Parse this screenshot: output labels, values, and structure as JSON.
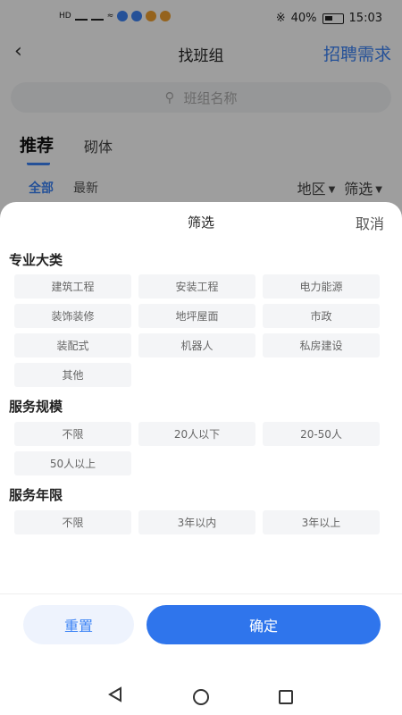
{
  "status_bar": {
    "battery": "40%",
    "time": "15:03"
  },
  "nav": {
    "title": "找班组",
    "action": "招聘需求"
  },
  "search": {
    "placeholder": "班组名称"
  },
  "tabs": [
    {
      "label": "推荐",
      "active": true
    },
    {
      "label": "砌体",
      "active": false
    }
  ],
  "subtabs": [
    {
      "label": "全部",
      "active": true
    },
    {
      "label": "最新",
      "active": false
    }
  ],
  "filters": [
    {
      "label": "地区"
    },
    {
      "label": "筛选"
    }
  ],
  "sheet": {
    "title": "筛选",
    "cancel": "取消",
    "sections": [
      {
        "title": "专业大类",
        "options": [
          "建筑工程",
          "安装工程",
          "电力能源",
          "装饰装修",
          "地坪屋面",
          "市政",
          "装配式",
          "机器人",
          "私房建设",
          "其他"
        ]
      },
      {
        "title": "服务规模",
        "options": [
          "不限",
          "20人以下",
          "20-50人",
          "50人以上"
        ]
      },
      {
        "title": "服务年限",
        "options": [
          "不限",
          "3年以内",
          "3年以上"
        ]
      }
    ],
    "reset": "重置",
    "confirm": "确定"
  },
  "colors": {
    "accent": "#2f75ec",
    "accent_light": "#eef3fd",
    "option_bg": "#f4f5f7"
  }
}
